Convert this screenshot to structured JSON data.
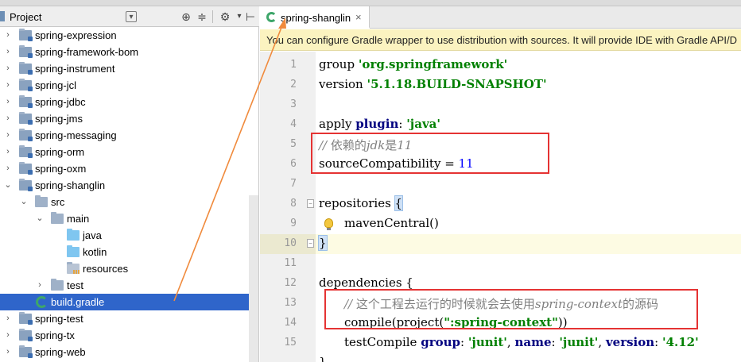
{
  "project_panel": {
    "title": "Project",
    "dropdown_icon": "chevron-down-icon",
    "toolbar_icons": [
      "target-icon",
      "collapse-all-icon",
      "gear-icon",
      "hide-icon"
    ]
  },
  "tree": [
    {
      "label": "spring-expression",
      "type": "module",
      "expanded": false
    },
    {
      "label": "spring-framework-bom",
      "type": "module",
      "expanded": false
    },
    {
      "label": "spring-instrument",
      "type": "module",
      "expanded": false
    },
    {
      "label": "spring-jcl",
      "type": "module",
      "expanded": false
    },
    {
      "label": "spring-jdbc",
      "type": "module",
      "expanded": false
    },
    {
      "label": "spring-jms",
      "type": "module",
      "expanded": false
    },
    {
      "label": "spring-messaging",
      "type": "module",
      "expanded": false
    },
    {
      "label": "spring-orm",
      "type": "module",
      "expanded": false
    },
    {
      "label": "spring-oxm",
      "type": "module",
      "expanded": false
    },
    {
      "label": "spring-shanglin",
      "type": "module",
      "expanded": true
    },
    {
      "label": "src",
      "type": "folder",
      "expanded": true
    },
    {
      "label": "main",
      "type": "folder",
      "expanded": true
    },
    {
      "label": "java",
      "type": "source",
      "expanded": null
    },
    {
      "label": "kotlin",
      "type": "source",
      "expanded": null
    },
    {
      "label": "resources",
      "type": "resources",
      "expanded": null
    },
    {
      "label": "test",
      "type": "folder",
      "expanded": false
    },
    {
      "label": "build.gradle",
      "type": "gradle",
      "expanded": null,
      "selected": true
    },
    {
      "label": "spring-test",
      "type": "module",
      "expanded": false
    },
    {
      "label": "spring-tx",
      "type": "module",
      "expanded": false
    },
    {
      "label": "spring-web",
      "type": "module",
      "expanded": false
    }
  ],
  "editor": {
    "tab_label": "spring-shanglin",
    "tab_close": "×",
    "notification": "You can configure Gradle wrapper to use distribution with sources. It will provide IDE with Gradle API/D",
    "line_numbers": [
      "1",
      "2",
      "3",
      "4",
      "5",
      "6",
      "7",
      "8",
      "9",
      "10",
      "11",
      "12",
      "13",
      "14",
      "15"
    ],
    "code": {
      "l1_kw": "group ",
      "l1_str": "'org.springframework'",
      "l2_kw": "version ",
      "l2_str": "'5.1.18.BUILD-SNAPSHOT'",
      "l4_a": "apply ",
      "l4_b": "plugin",
      "l4_c": ": ",
      "l4_d": "'java'",
      "l5_a": "// ",
      "l5_b": "依赖的",
      "l5_c": "jdk",
      "l5_d": "是",
      "l5_e": "11",
      "l6_a": "sourceCompatibility = ",
      "l6_b": "11",
      "l8_a": "repositories ",
      "l8_b": "{",
      "l9": "mavenCentral()",
      "l10": "}",
      "l12": "dependencies {",
      "l13_a": "// ",
      "l13_b": "这个工程去运行的时候就会去使用",
      "l13_c": "spring-context",
      "l13_d": "的源码",
      "l14_a": "compile(project(",
      "l14_b": "\":spring-context\"",
      "l14_c": "))",
      "l15_a": "testCompile ",
      "l15_b": "group",
      "l15_c": ": ",
      "l15_d": "'junit'",
      "l15_e": ", ",
      "l15_f": "name",
      "l15_g": ": ",
      "l15_h": "'junit'",
      "l15_i": ", ",
      "l15_j": "version",
      "l15_k": ": ",
      "l15_l": "'4.12'",
      "l16": "}"
    }
  },
  "annotation_color": "#e53333",
  "arrow_color": "#f08a3c"
}
